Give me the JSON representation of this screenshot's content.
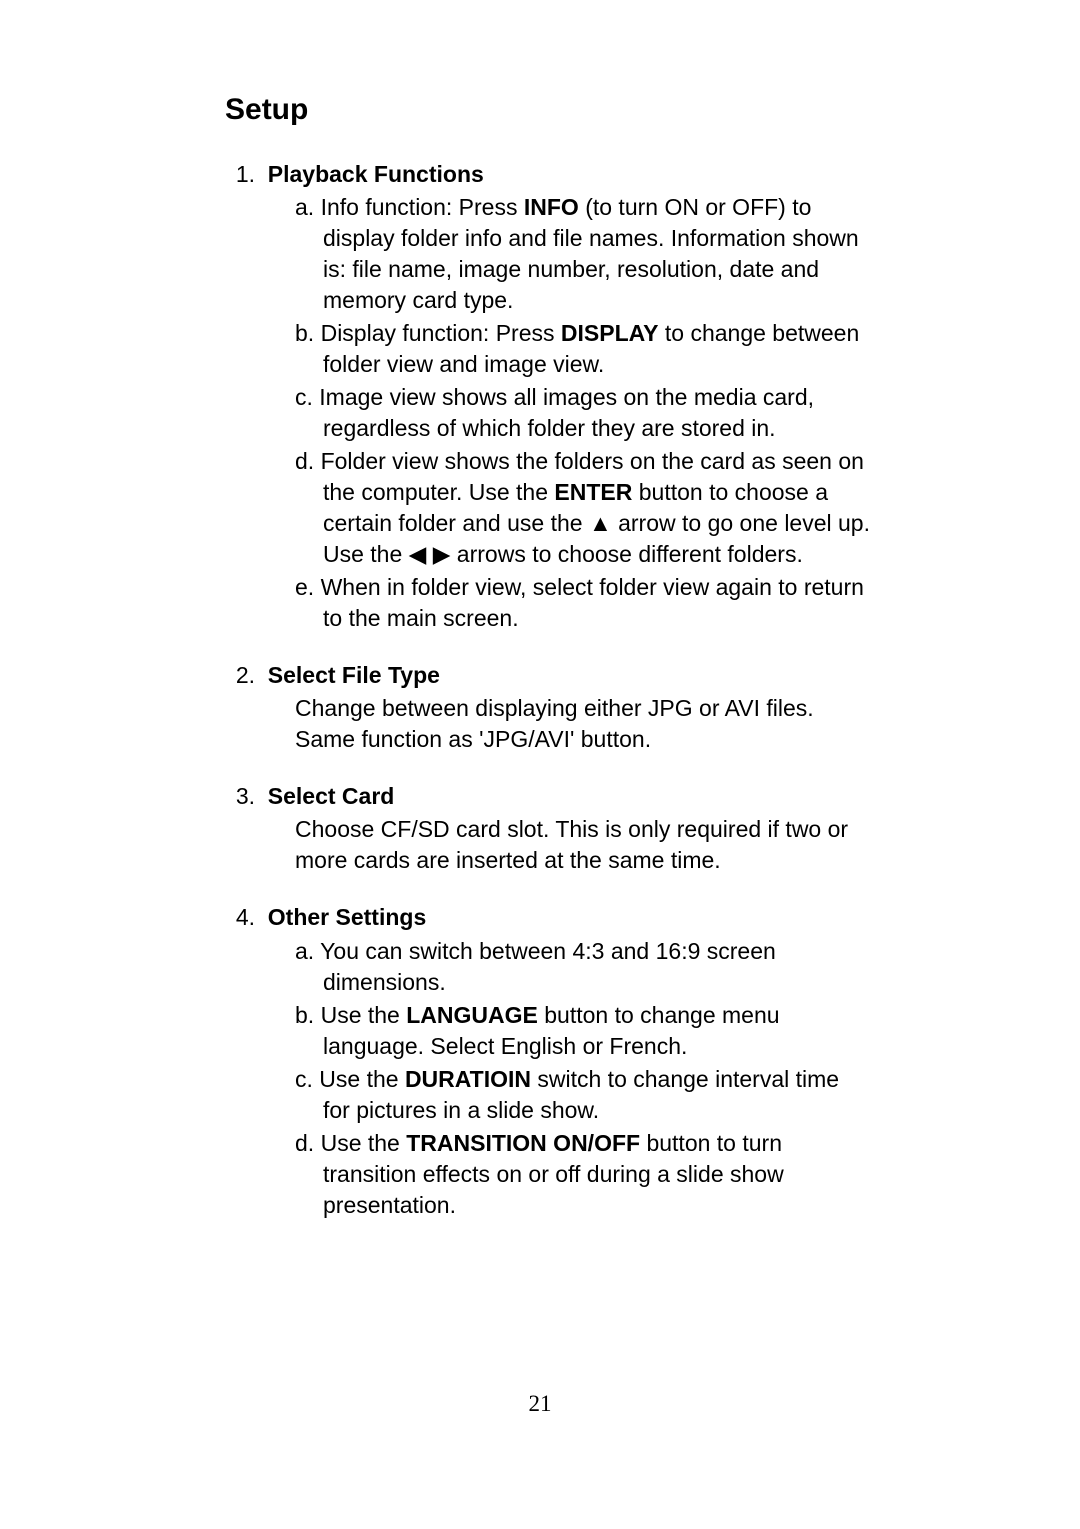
{
  "title": "Setup",
  "pageNumber": "21",
  "items": [
    {
      "num": "1.",
      "heading": "Playback Functions",
      "subs": [
        {
          "label": "a.",
          "pre": "Info function: Press ",
          "bold": "INFO",
          "post": " (to turn ON or OFF) to display folder info and file names. Information shown is: file name, image number, resolution, date and memory card type."
        },
        {
          "label": "b.",
          "pre": "Display function: Press ",
          "bold": "DISPLAY",
          "post": " to change between folder view and image view."
        },
        {
          "label": "c.",
          "pre": "Image view shows all images on the media card, regardless of which folder they are stored in.",
          "bold": "",
          "post": ""
        },
        {
          "label": "d.",
          "pre": "Folder view shows the folders on the card as seen on the computer. Use the ",
          "bold": "ENTER",
          "post": " button to choose a certain folder and use the ▲ arrow to go one level up. Use the ◀ ▶ arrows to choose different folders."
        },
        {
          "label": "e.",
          "pre": "When in folder view, select folder view again to return to the main screen.",
          "bold": "",
          "post": ""
        }
      ]
    },
    {
      "num": "2.",
      "heading": "Select File Type",
      "body": "Change between displaying either JPG or AVI files. Same function as 'JPG/AVI' button."
    },
    {
      "num": "3.",
      "heading": "Select Card",
      "body": "Choose CF/SD card slot. This is only required if two or more cards are inserted at the same time."
    },
    {
      "num": "4.",
      "heading": "Other Settings",
      "subs": [
        {
          "label": "a.",
          "pre": "You can switch between 4:3 and 16:9 screen dimensions.",
          "bold": "",
          "post": ""
        },
        {
          "label": "b.",
          "pre": "Use the ",
          "bold": "LANGUAGE",
          "post": " button to change menu language. Select English or French."
        },
        {
          "label": "c.",
          "pre": "Use the ",
          "bold": "DURATIOIN",
          "post": " switch to change interval time for pictures in a slide show."
        },
        {
          "label": "d.",
          "pre": "Use the ",
          "bold": "TRANSITION ON/OFF",
          "post": " button to turn transition effects on or off during a slide show presentation."
        }
      ]
    }
  ]
}
